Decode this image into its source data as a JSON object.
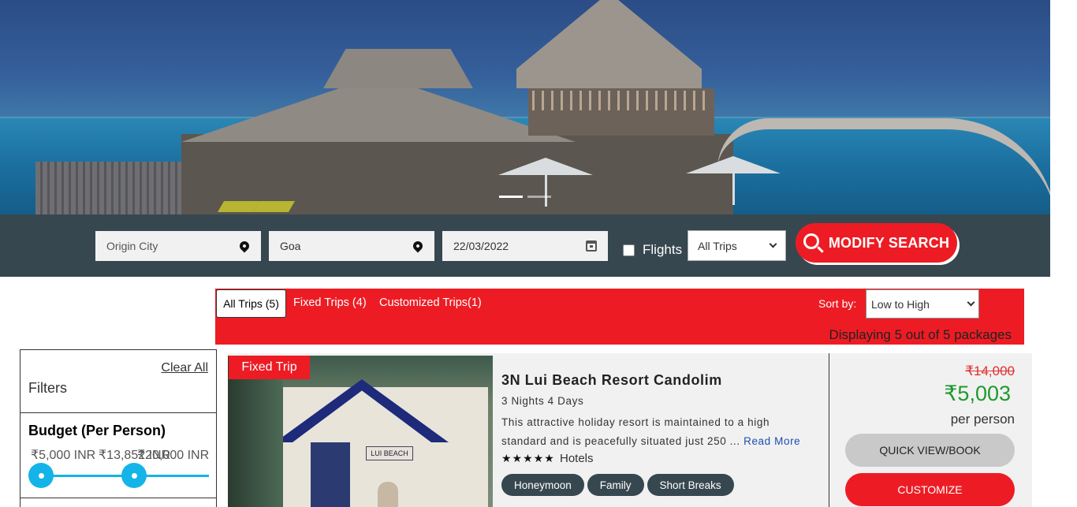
{
  "search": {
    "origin_placeholder": "Origin City",
    "destination_value": "Goa",
    "date_value": "22/03/2022",
    "flights_label": "Flights",
    "flights_checked": false,
    "trip_type_selected": "All Trips",
    "modify_button_label": "MODIFY SEARCH"
  },
  "hero": {
    "slide_count": 2,
    "active_slide": 1,
    "icons": [
      "map-pin-icon",
      "calendar-icon",
      "search-icon",
      "chevron-down-icon"
    ]
  },
  "tabs": {
    "all_trips": "All Trips (5)",
    "fixed_trips": "Fixed Trips (4)",
    "customized_trips": "Customized Trips(1)",
    "sort_label": "Sort by:",
    "sort_selected": "Low to High",
    "displaying_text": "Displaying 5 out of 5 packages"
  },
  "filters": {
    "title": "Filters",
    "clear_all": "Clear All",
    "budget_title": "Budget (Per Person)",
    "min_label": "₹5,000 INR",
    "mid_label": "₹13,852 INR",
    "max_label": "₹20,000 INR"
  },
  "package": {
    "tag": "Fixed Trip",
    "title": "3N Lui Beach Resort Candolim",
    "duration": "3 Nights 4 Days",
    "description": "This attractive holiday resort is maintained to a high standard and is peacefully situated just 250 ...",
    "read_more": "Read More",
    "stars": "★★★★★",
    "rating": 5,
    "hotels_label": "Hotels",
    "image_sign_text": "LUI BEACH",
    "chips": [
      "Honeymoon",
      "Family",
      "Short Breaks"
    ],
    "old_price": "₹14,000",
    "price": "₹5,003",
    "per_person": "per person",
    "quick_view_label": "QUICK VIEW/BOOK",
    "customize_label": "CUSTOMIZE"
  },
  "colors": {
    "brand_red": "#ed1c24",
    "bar_dark": "#37474f",
    "slider_blue": "#14b4e8",
    "price_green": "#1f9a2e"
  }
}
